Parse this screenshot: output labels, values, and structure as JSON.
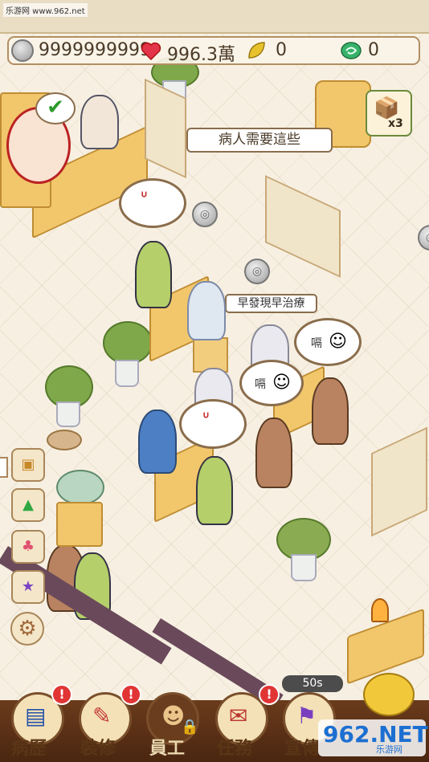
{
  "watermark": "乐游网 www.962.net",
  "resources": {
    "coins": "9999999999",
    "hearts": "996.3萬",
    "leaves": "0",
    "jade": "0"
  },
  "hint_text": "病人需要這些",
  "slogan": "早發現早治療",
  "speech_bubbles": [
    {
      "id": "patient-1",
      "text": ""
    },
    {
      "id": "patient-2",
      "text": "嗝"
    },
    {
      "id": "patient-3",
      "text": "嗝"
    },
    {
      "id": "patient-4",
      "text": ""
    }
  ],
  "item_count": "x3",
  "timer": "50s",
  "side_menu": [
    {
      "name": "chest",
      "icon": "treasure-chest-icon"
    },
    {
      "name": "upgrade",
      "icon": "green-arrow-up-icon"
    },
    {
      "name": "outfit",
      "icon": "clothes-icon"
    },
    {
      "name": "favorite",
      "icon": "purple-star-icon"
    },
    {
      "name": "settings",
      "icon": "gear-icon"
    }
  ],
  "bottom_menu": [
    {
      "label": "病歷",
      "alert": "!"
    },
    {
      "label": "裝修",
      "alert": "!"
    },
    {
      "label": "員工",
      "alert": ""
    },
    {
      "label": "任務",
      "alert": "!"
    },
    {
      "label": "宣傳",
      "alert": ""
    }
  ],
  "brand_logo": {
    "big": "962.NET",
    "small": "乐游网"
  },
  "colors": {
    "accent": "#b28e63",
    "alert": "#e13434",
    "wood": "#f2c76c"
  }
}
